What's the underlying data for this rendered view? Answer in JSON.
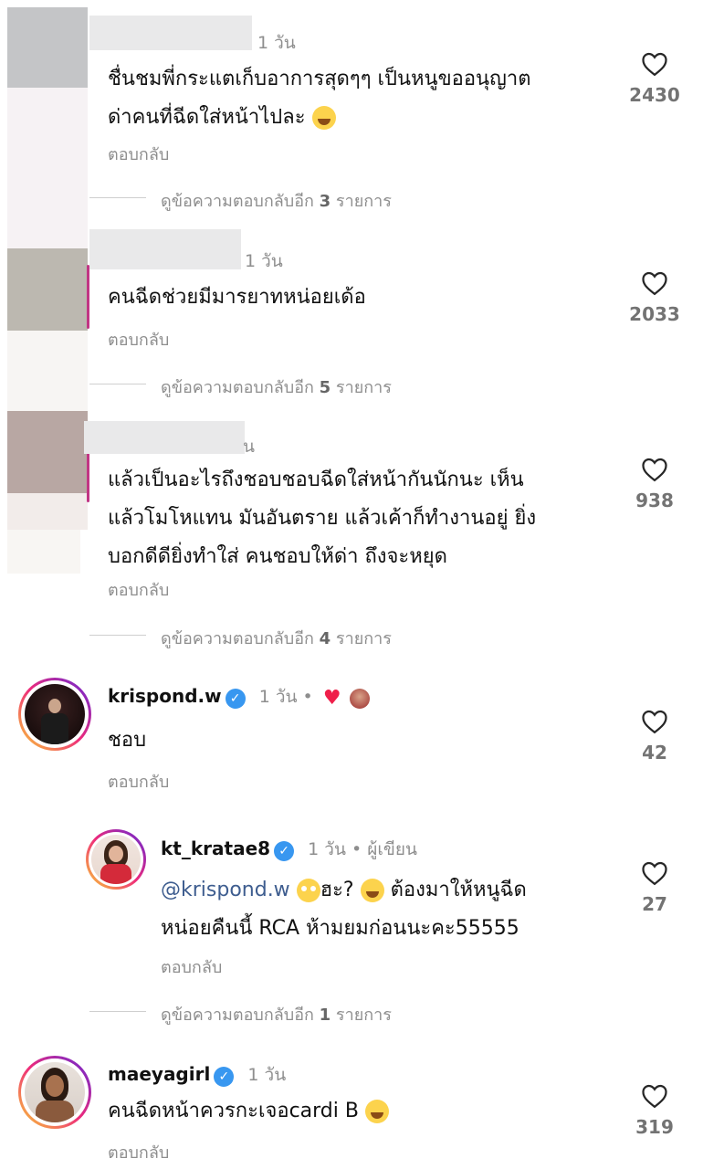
{
  "comments": [
    {
      "time": "1 วัน",
      "text_lines": [
        "ชื่นชมพี่กระแตเก็บอาการสุดๆๆ เป็นหนูขออนุญาต",
        "ด่าคนที่ฉีดใส่หน้าไปละ"
      ],
      "reply": "ตอบกลับ",
      "likes": "2430",
      "view_more_prefix": "ดูข้อความตอบกลับอีก",
      "view_more_count": "3",
      "view_more_suffix": "รายการ"
    },
    {
      "time": "1 วัน",
      "text_lines": [
        "คนฉีดช่วยมีมารยาทหน่อยเด้อ"
      ],
      "reply": "ตอบกลับ",
      "likes": "2033",
      "view_more_prefix": "ดูข้อความตอบกลับอีก",
      "view_more_count": "5",
      "view_more_suffix": "รายการ"
    },
    {
      "time": "น",
      "text_lines": [
        "แล้วเป็นอะไรถึงชอบชอบฉีดใส่หน้ากันนักนะ เห็น",
        "แล้วโมโหแทน มันอันตราย แล้วเค้าก็ทำงานอยู่ ยิ่ง",
        "บอกดีดียิ่งทำใส่ คนชอบให้ด่า ถึงจะหยุด"
      ],
      "reply": "ตอบกลับ",
      "likes": "938",
      "view_more_prefix": "ดูข้อความตอบกลับอีก",
      "view_more_count": "4",
      "view_more_suffix": "รายการ"
    },
    {
      "username": "krispond.w",
      "time": "1 วัน •",
      "text": "ชอบ",
      "reply": "ตอบกลับ",
      "likes": "42"
    },
    {
      "username": "kt_kratae8",
      "time": "1 วัน • ผู้เขียน",
      "mention": "@krispond.w",
      "text_part1": "ฮะ?",
      "text_part2": "ต้องมาให้หนูฉีด",
      "text_line2": "หน่อยคืนนี้ RCA ห้ามยมก่อนนะคะ55555",
      "reply": "ตอบกลับ",
      "likes": "27",
      "view_more_prefix": "ดูข้อความตอบกลับอีก",
      "view_more_count": "1",
      "view_more_suffix": "รายการ"
    },
    {
      "username": "maeyagirl",
      "time": "1 วัน",
      "text": "คนฉีดหน้าควรกะเจอcardi B",
      "reply": "ตอบกลับ",
      "likes": "319"
    }
  ],
  "icons": {
    "like": "heart-outline-icon",
    "verified": "verified-badge-icon",
    "laugh": "face-with-tears-of-joy-emoji",
    "flushed": "flushed-face-emoji",
    "liked_by_author": "red-heart-icon"
  },
  "colors": {
    "text": "#111111",
    "secondary": "#8e8e8e",
    "verified": "#3897f0",
    "mention": "#3e5d8f",
    "heart_red": "#ef1f4a"
  }
}
